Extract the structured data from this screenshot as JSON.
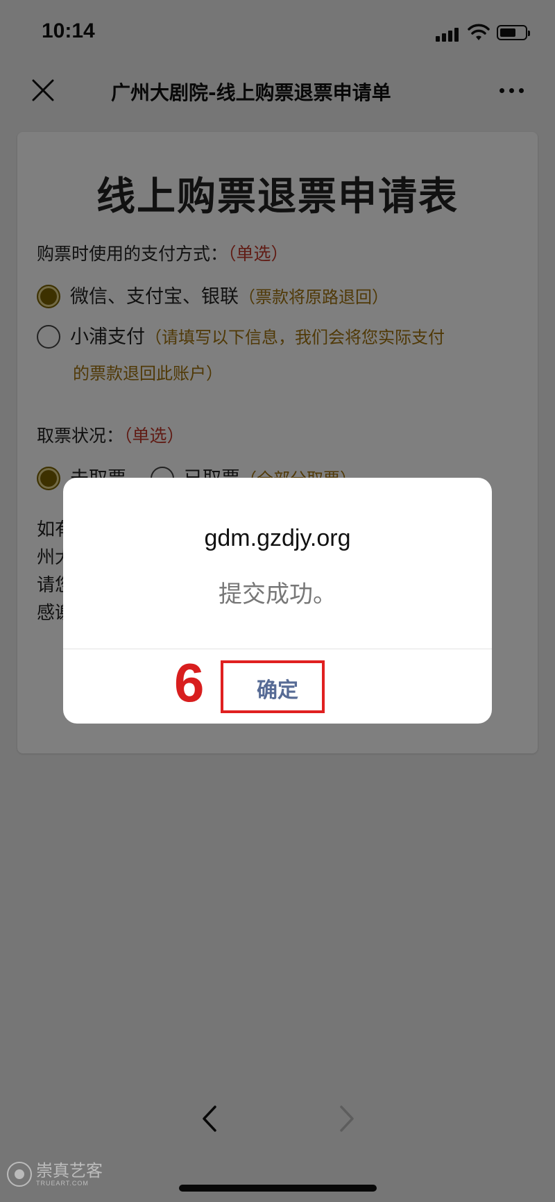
{
  "status_bar": {
    "time": "10:14"
  },
  "nav": {
    "title": "广州大剧院-线上购票退票申请单"
  },
  "form": {
    "title": "线上购票退票申请表",
    "q1": {
      "label": "购票时使用的支付方式：",
      "hint": "（单选）",
      "options": [
        {
          "label": "微信、支付宝、银联",
          "note": "（票款将原路退回）",
          "selected": true
        },
        {
          "label": "小浦支付",
          "note": "（请填写以下信息，我们会将您实际支付",
          "note_line2": "的票款退回此账户）",
          "selected": false
        }
      ]
    },
    "q2": {
      "label": "取票状况：",
      "hint": "（单选）",
      "options": [
        {
          "label": "未取票",
          "selected": true
        },
        {
          "label": "已取票",
          "note": "（全部分取票）",
          "selected": false
        }
      ]
    },
    "body_lines": [
      "如有",
      "州大",
      "请您",
      "感谢"
    ]
  },
  "dialog": {
    "host": "gdm.gzdjy.org",
    "message": "提交成功。",
    "confirm_label": "确定",
    "annotation_number": "6"
  },
  "watermark": {
    "cn": "崇真艺客",
    "en": "TRUEART.COM"
  },
  "colors": {
    "dialog_button": "#576b95",
    "annotation": "#e02020",
    "radio_checked": "#7a6300",
    "hint": "#c0392b",
    "note": "#a0730e"
  },
  "icons": {
    "close": "close-icon",
    "more": "more-icon",
    "back": "chevron-left-icon",
    "forward": "chevron-right-icon"
  }
}
